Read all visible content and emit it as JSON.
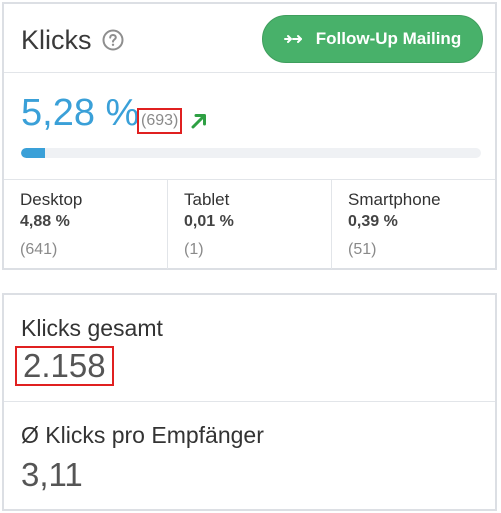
{
  "header": {
    "title": "Klicks",
    "follow_up_label": "Follow-Up Mailing"
  },
  "metric": {
    "rate": "5,28 %",
    "count": "(693)",
    "progress_percent": 5.28
  },
  "devices": [
    {
      "name": "Desktop",
      "rate": "4,88 %",
      "count": "(641)"
    },
    {
      "name": "Tablet",
      "rate": "0,01 %",
      "count": "(1)"
    },
    {
      "name": "Smartphone",
      "rate": "0,39 %",
      "count": "(51)"
    }
  ],
  "totals": {
    "total_label": "Klicks gesamt",
    "total_value": "2.158",
    "per_recipient_label": "Ø Klicks pro Empfänger",
    "per_recipient_value": "3,11"
  },
  "colors": {
    "accent_blue": "#3aa0d8",
    "button_green": "#48b16a",
    "highlight_red": "#e02020",
    "trend_green": "#2ea043"
  },
  "icons": {
    "help": "help-circle-icon",
    "button": "forward-arrows-icon",
    "trend": "trend-up-arrow-icon"
  }
}
